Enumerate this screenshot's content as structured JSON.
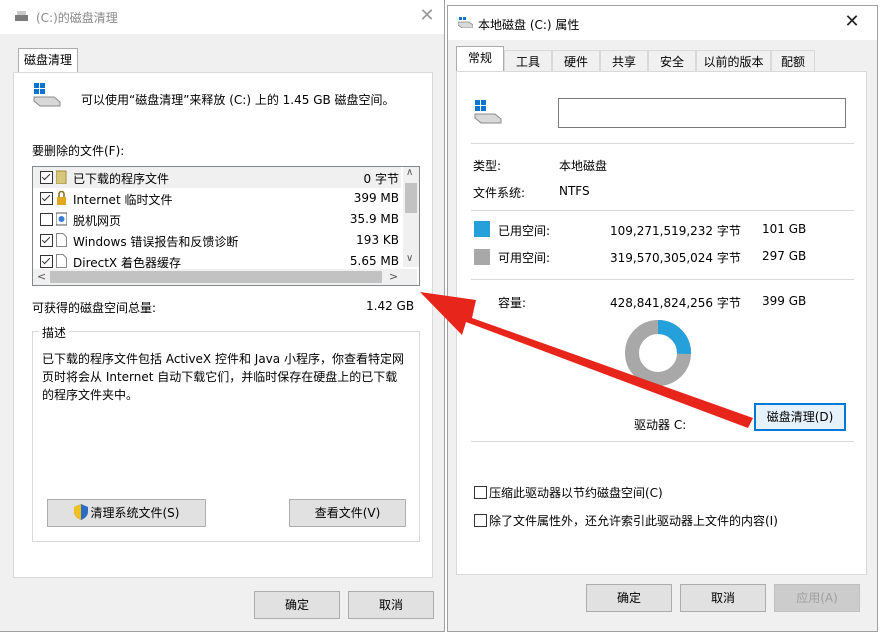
{
  "cleanup": {
    "title": "(C:)的磁盘清理",
    "tab": "磁盘清理",
    "intro": "可以使用“磁盘清理”来释放  (C:) 上的 1.45 GB 磁盘空间。",
    "files_label": "要删除的文件(F):",
    "files": [
      {
        "name": "已下载的程序文件",
        "size": "0 字节",
        "checked": true,
        "icon": "folder-icon"
      },
      {
        "name": "Internet 临时文件",
        "size": "399 MB",
        "checked": true,
        "icon": "lock-icon"
      },
      {
        "name": "脱机网页",
        "size": "35.9 MB",
        "checked": false,
        "icon": "offline-page-icon"
      },
      {
        "name": "Windows 错误报告和反馈诊断",
        "size": "193 KB",
        "checked": true,
        "icon": "file-icon"
      },
      {
        "name": "DirectX 着色器缓存",
        "size": "5.65 MB",
        "checked": true,
        "icon": "file-icon"
      }
    ],
    "total_label": "可获得的磁盘空间总量:",
    "total_value": "1.42 GB",
    "desc_title": "描述",
    "desc_line1": "已下载的程序文件包括 ActiveX 控件和 Java 小程序，你查看特定网",
    "desc_line2": "页时将会从 Internet 自动下载它们，并临时保存在硬盘上的已下载",
    "desc_line3": "的程序文件夹中。",
    "clean_sys_btn": "清理系统文件(S)",
    "view_files_btn": "查看文件(V)",
    "ok": "确定",
    "cancel": "取消"
  },
  "props": {
    "title": "本地磁盘 (C:) 属性",
    "tabs": [
      "常规",
      "工具",
      "硬件",
      "共享",
      "安全",
      "以前的版本",
      "配额"
    ],
    "name_value": "",
    "type_label": "类型:",
    "type_value": "本地磁盘",
    "fs_label": "文件系统:",
    "fs_value": "NTFS",
    "used_label": "已用空间:",
    "used_bytes": "109,271,519,232 字节",
    "used_size": "101 GB",
    "free_label": "可用空间:",
    "free_bytes": "319,570,305,024 字节",
    "free_size": "297 GB",
    "cap_label": "容量:",
    "cap_bytes": "428,841,824,256 字节",
    "cap_size": "399 GB",
    "used_fraction": 0.255,
    "used_color": "#26a0da",
    "free_color": "#a8a8a8",
    "drive_label": "驱动器 C:",
    "cleanup_btn": "磁盘清理(D)",
    "compress_label": "压缩此驱动器以节约磁盘空间(C)",
    "index_label": "除了文件属性外，还允许索引此驱动器上文件的内容(I)",
    "ok": "确定",
    "cancel": "取消",
    "apply": "应用(A)"
  }
}
